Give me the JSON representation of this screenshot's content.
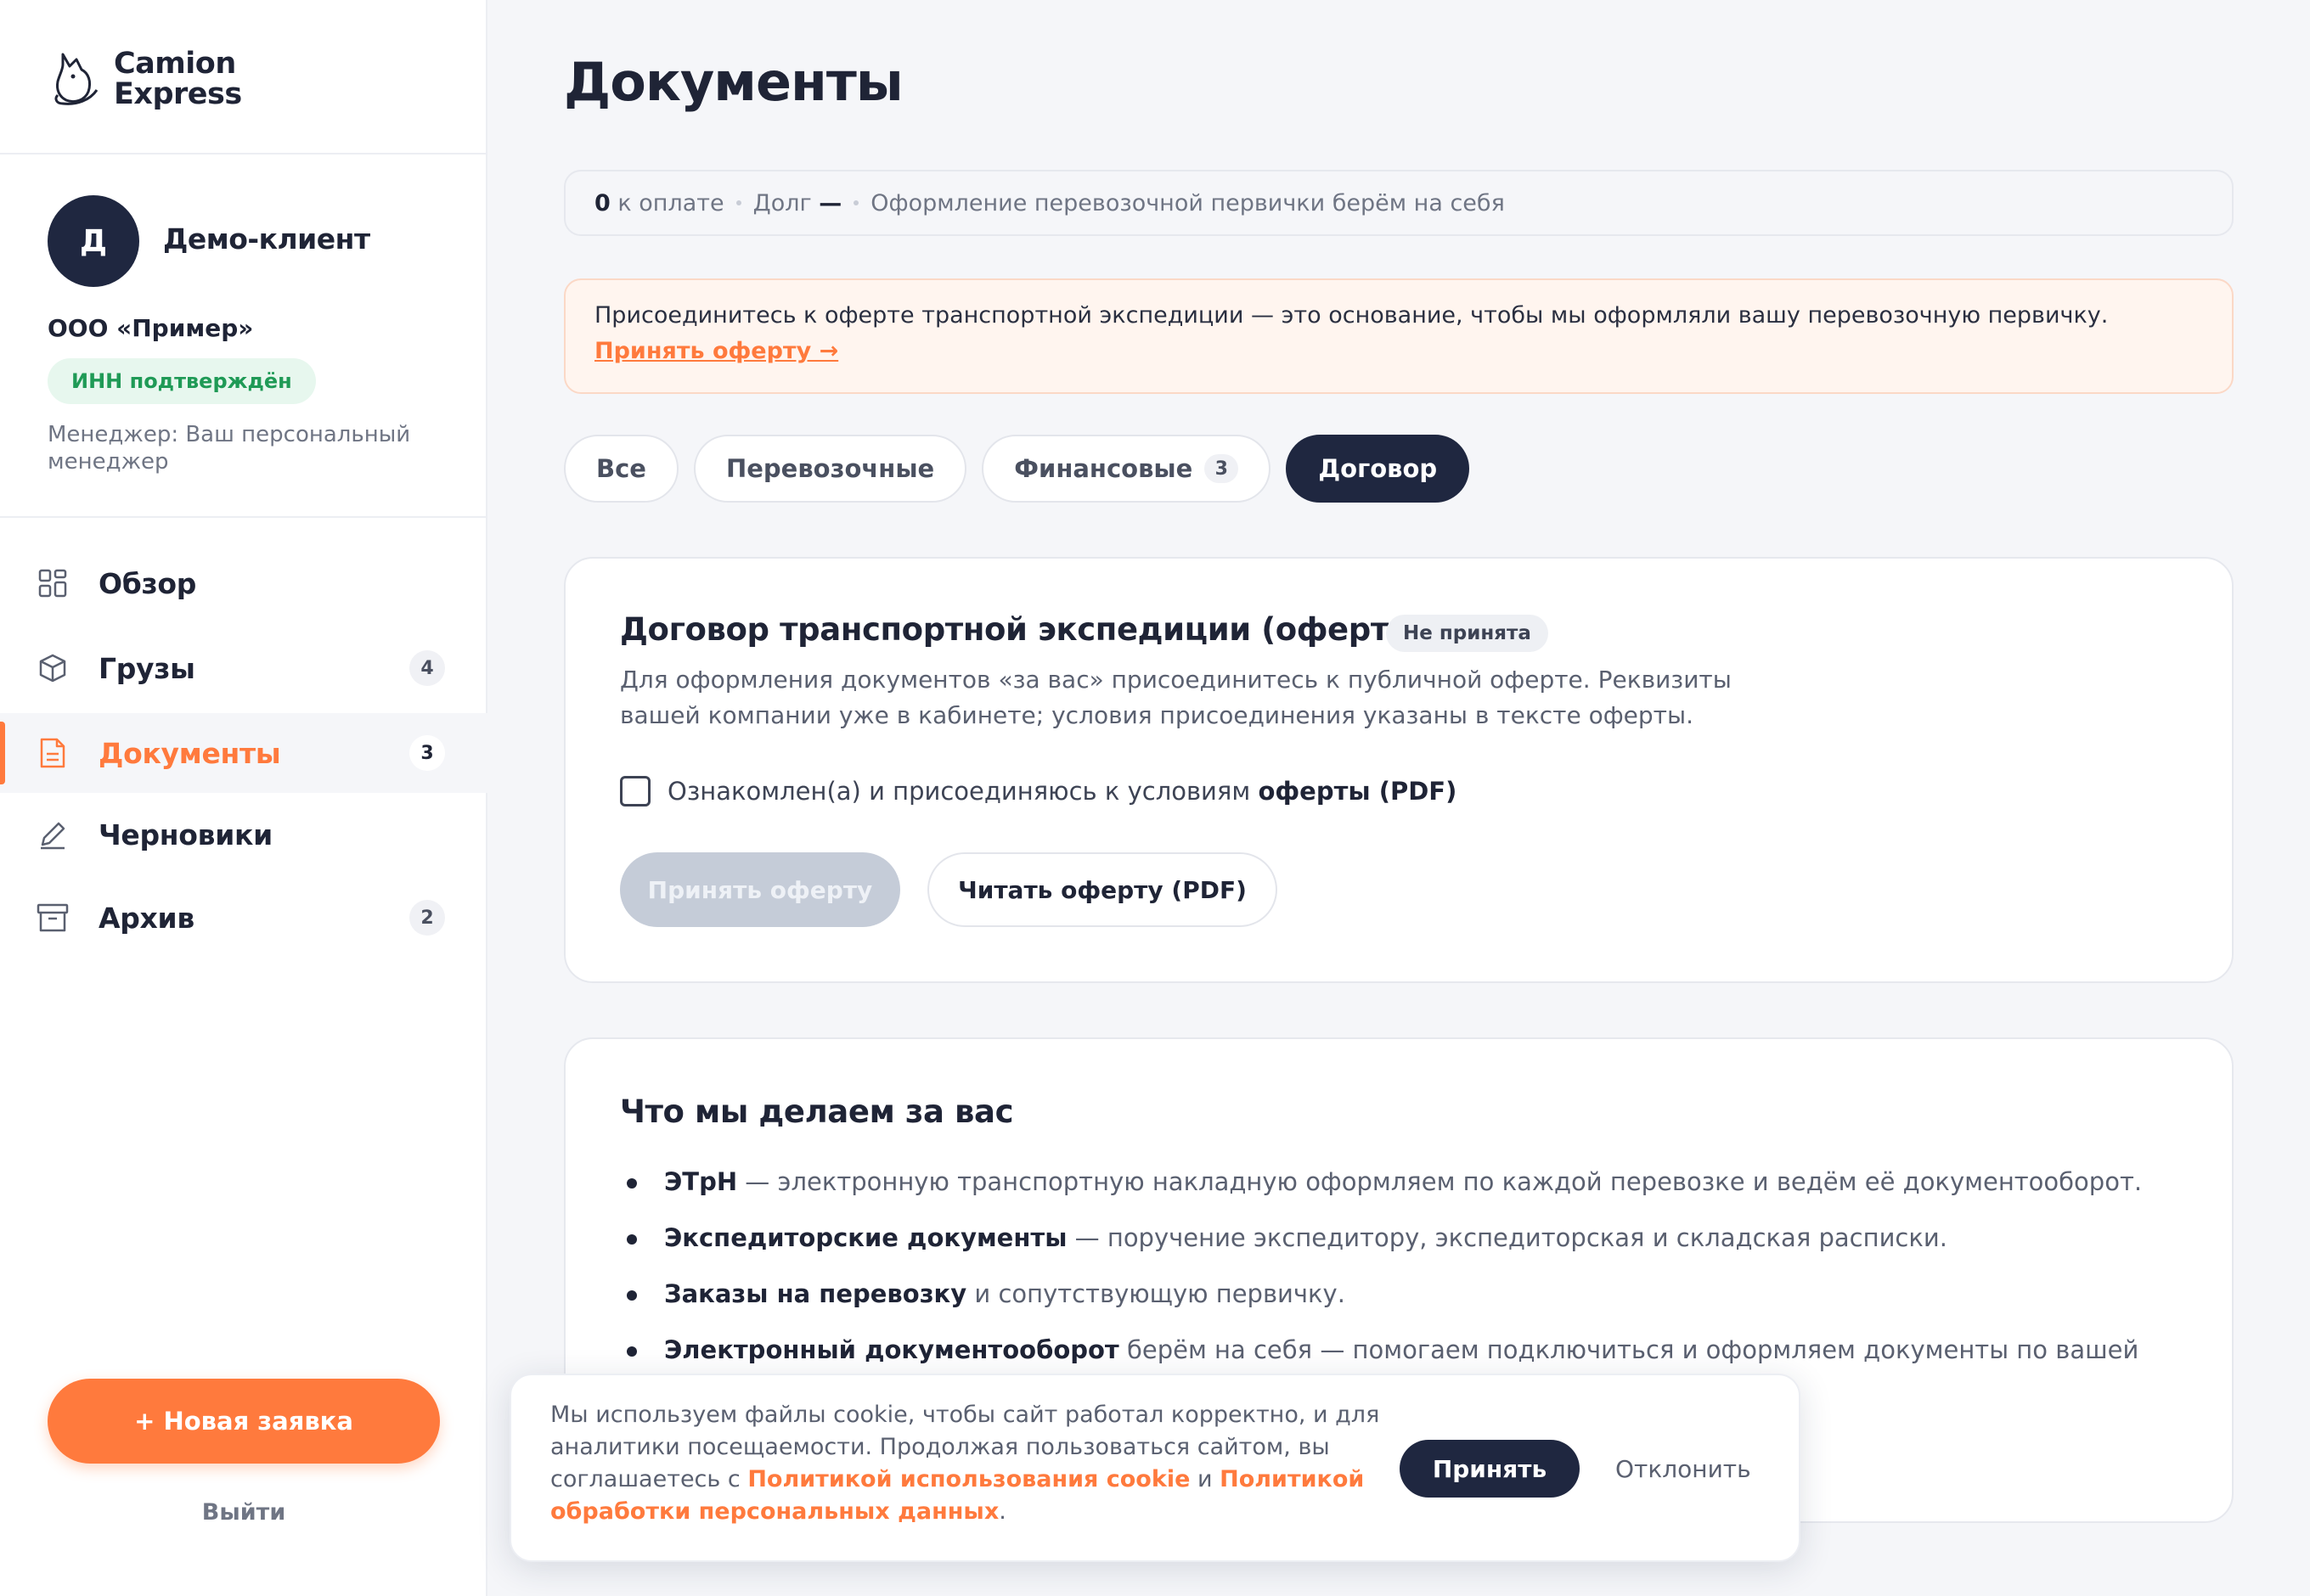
{
  "brand": {
    "line1": "Camion",
    "line2": "Express"
  },
  "user": {
    "avatar_letter": "Д",
    "name": "Демо-клиент",
    "company": "ООО «Пример»",
    "inn_badge": "ИНН подтверждён",
    "manager": "Менеджер: Ваш персональный менеджер"
  },
  "sidebar": {
    "items": [
      {
        "label": "Обзор",
        "icon": "grid-icon",
        "badge": ""
      },
      {
        "label": "Грузы",
        "icon": "box-icon",
        "badge": "4"
      },
      {
        "label": "Документы",
        "icon": "document-icon",
        "badge": "3",
        "active": true
      },
      {
        "label": "Черновики",
        "icon": "pencil-icon",
        "badge": ""
      },
      {
        "label": "Архив",
        "icon": "archive-icon",
        "badge": "2"
      }
    ],
    "new_request": "+ Новая заявка",
    "logout": "Выйти"
  },
  "page": {
    "title": "Документы",
    "stats": {
      "to_pay_value": "0",
      "to_pay_label": "к оплате",
      "debt_label": "Долг",
      "debt_value": "—",
      "note": "Оформление перевозочной первички берём на себя"
    },
    "alert": {
      "text": "Присоединитесь к оферте транспортной экспедиции — это основание, чтобы мы оформляли вашу перевозочную первичку.",
      "link": "Принять оферту →"
    },
    "tabs": [
      {
        "label": "Все",
        "count": ""
      },
      {
        "label": "Перевозочные",
        "count": ""
      },
      {
        "label": "Финансовые",
        "count": "3"
      },
      {
        "label": "Договор",
        "count": "",
        "active": true
      }
    ]
  },
  "contract_card": {
    "title": "Договор транспортной экспедиции (оферта)",
    "status": "Не принята",
    "description": "Для оформления документов «за вас» присоединитесь к публичной оферте. Реквизиты вашей компании уже в кабинете; условия присоединения указаны в тексте оферты.",
    "checkbox_label": "Ознакомлен(а) и присоединяюсь к условиям",
    "checkbox_link": "оферты (PDF)",
    "checkbox_checked": false,
    "accept_button": "Принять оферту",
    "read_button": "Читать оферту (PDF)"
  },
  "services_card": {
    "title": "Что мы делаем за вас",
    "items": [
      {
        "bold": "ЭТрН",
        "text": " — электронную транспортную накладную оформляем по каждой перевозке и ведём её документооборот."
      },
      {
        "bold": "Экспедиторские документы",
        "text": " — поручение экспедитору, экспедиторская и складская расписки."
      },
      {
        "bold": "Заказы на перевозку",
        "text": " и сопутствующую первичку."
      },
      {
        "bold": "Электронный документооборот",
        "text": " берём на себя — помогаем подключиться и оформляем документы по вашей"
      }
    ]
  },
  "cookie": {
    "text1": "Мы используем файлы cookie, чтобы сайт работал корректно, и для аналитики посещаемости. Продолжая пользоваться сайтом, вы соглашаетесь с ",
    "link1": "Политикой использования cookie",
    "and": " и ",
    "link2": "Политикой обработки персональных данных",
    "end": ".",
    "accept": "Принять",
    "decline": "Отклонить"
  },
  "colors": {
    "accent": "#ff7a3d",
    "dark": "#1f2740",
    "success": "#1f9a56"
  }
}
